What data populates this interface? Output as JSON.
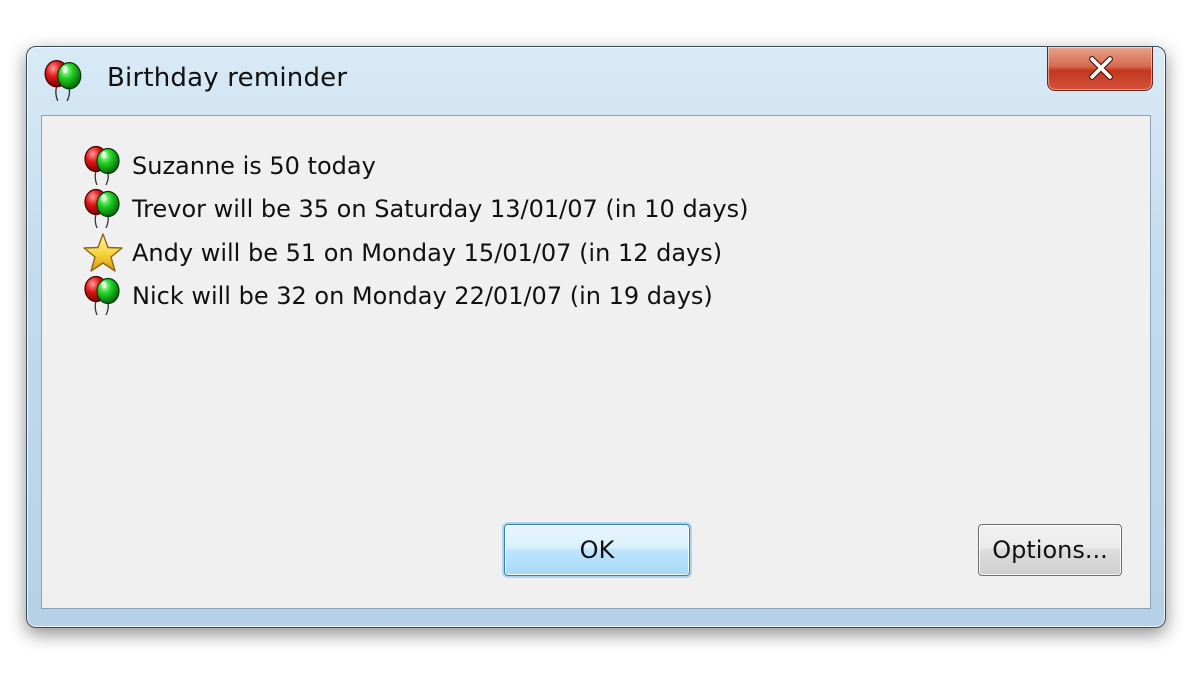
{
  "window": {
    "title": "Birthday reminder",
    "title_icon": "balloons-icon",
    "close_icon": "close-icon",
    "colors": {
      "close_button": "#c8412a",
      "client_background": "#f0f0f0",
      "ok_button_highlight": "#bee6fd"
    }
  },
  "reminders": [
    {
      "icon": "balloons-icon",
      "text": "Suzanne is 50 today"
    },
    {
      "icon": "balloons-icon",
      "text": "Trevor will be 35 on Saturday 13/01/07 (in 10 days)"
    },
    {
      "icon": "star-icon",
      "text": "Andy will be 51 on Monday 15/01/07 (in 12 days)"
    },
    {
      "icon": "balloons-icon",
      "text": "Nick will be 32 on Monday 22/01/07 (in 19 days)"
    }
  ],
  "buttons": {
    "ok_label": "OK",
    "options_label": "Options..."
  }
}
